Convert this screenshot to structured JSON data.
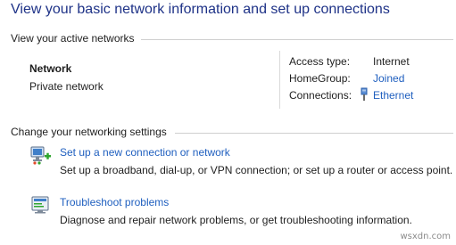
{
  "page": {
    "title": "View your basic network information and set up connections"
  },
  "active_networks": {
    "header": "View your active networks",
    "network_name": "Network",
    "network_type": "Private network",
    "properties": [
      {
        "label": "Access type:",
        "value": "Internet"
      },
      {
        "label": "HomeGroup:",
        "value": "Joined"
      },
      {
        "label": "Connections:",
        "value": "Ethernet",
        "icon": "ethernet-icon"
      }
    ]
  },
  "settings": {
    "header": "Change your networking settings",
    "tasks": [
      {
        "link": "Set up a new connection or network",
        "description": "Set up a broadband, dial-up, or VPN connection; or set up a router or access point.",
        "icon": "new-connection-icon"
      },
      {
        "link": "Troubleshoot problems",
        "description": "Diagnose and repair network problems, or get troubleshooting information.",
        "icon": "troubleshoot-icon"
      }
    ]
  },
  "watermark": "wsxdn.com",
  "colors": {
    "title": "#1e3287",
    "link": "#1f5fbf",
    "text": "#1e1e1e",
    "rule": "#cfcfcf"
  }
}
